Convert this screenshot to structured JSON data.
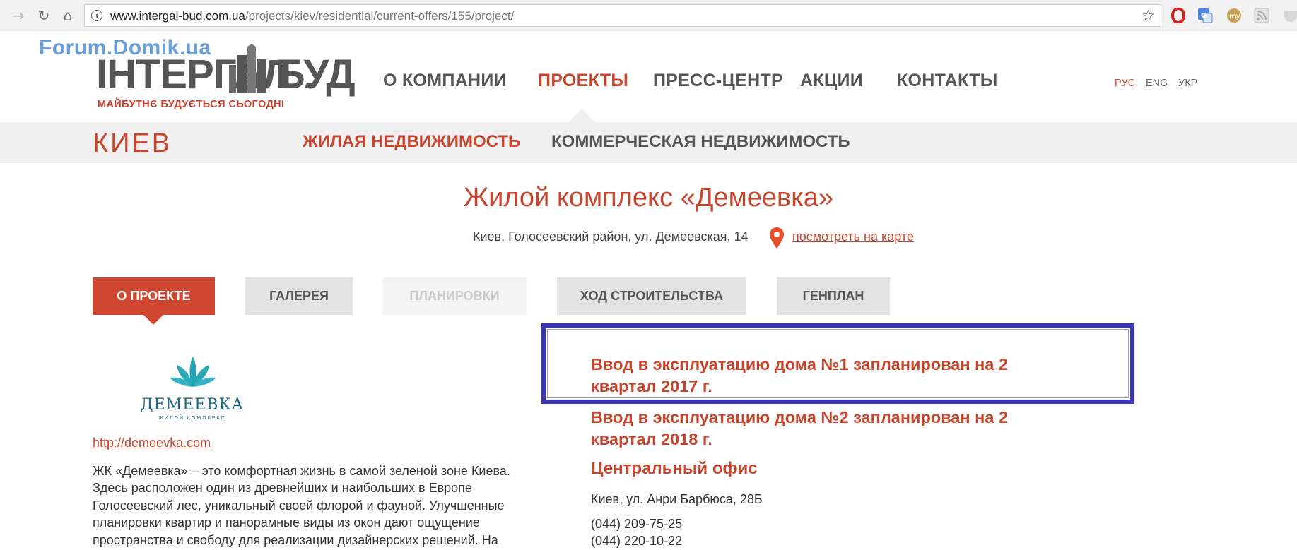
{
  "browser": {
    "url_domain": "www.intergal-bud.com.ua",
    "url_path": "/projects/kiev/residential/current-offers/155/project/"
  },
  "watermark": "Forum.Domik.ua",
  "logo": {
    "part1": "ІНТЕРГАЛ",
    "part2": "БУД",
    "tagline": "МАЙБУТНЄ БУДУЄТЬСЯ СЬОГОДНІ"
  },
  "main_nav": [
    {
      "label": "О КОМПАНИИ"
    },
    {
      "label": "ПРОЕКТЫ"
    },
    {
      "label": "ПРЕСС-ЦЕНТР"
    },
    {
      "label": "АКЦИИ"
    },
    {
      "label": "КОНТАКТЫ"
    }
  ],
  "languages": [
    {
      "label": "РУС"
    },
    {
      "label": "ENG"
    },
    {
      "label": "УКР"
    }
  ],
  "subnav": {
    "city": "КИЕВ",
    "items": [
      {
        "label": "ЖИЛАЯ НЕДВИЖИМОСТЬ"
      },
      {
        "label": "КОММЕРЧЕСКАЯ НЕДВИЖИМОСТЬ"
      }
    ]
  },
  "project": {
    "title": "Жилой комплекс «Демеевка»",
    "address": "Киев, Голосеевский район, ул. Демеевская, 14",
    "map_link": "посмотреть на карте"
  },
  "tabs": [
    {
      "label": "О ПРОЕКТЕ"
    },
    {
      "label": "ГАЛЕРЕЯ"
    },
    {
      "label": "ПЛАНИРОВКИ"
    },
    {
      "label": "ХОД СТРОИТЕЛЬСТВА"
    },
    {
      "label": "ГЕНПЛАН"
    }
  ],
  "project_logo": {
    "name": "ДЕМЕЕВКА",
    "subtitle": "ЖИЛОЙ КОМПЛЕКС"
  },
  "site_link": "http://demeevka.com",
  "description": "ЖК «Демеевка» – это комфортная жизнь в самой зеленой зоне Киева. Здесь расположен один из древнейших и наибольших в Европе Голосеевский лес, уникальный своей флорой и фауной. Улучшенные планировки квартир и панорамные виды из окон дают ощущение пространства и свободу для реализации дизайнерских решений. На",
  "news": [
    {
      "text": "Ввод в эксплуатацию дома №1 запланирован на 2 квартал 2017 г."
    },
    {
      "text": "Ввод в эксплуатацию дома №2 запланирован на 2 квартал 2018 г."
    }
  ],
  "office": {
    "title": "Центральный офис",
    "address": "Киев, ул. Анри Барбюса, 28Б",
    "phones": [
      "(044) 209-75-25",
      "(044) 220-10-22"
    ]
  },
  "colors": {
    "accent": "#c8452d",
    "highlight_border": "#3b35b2",
    "text": "#555555"
  }
}
